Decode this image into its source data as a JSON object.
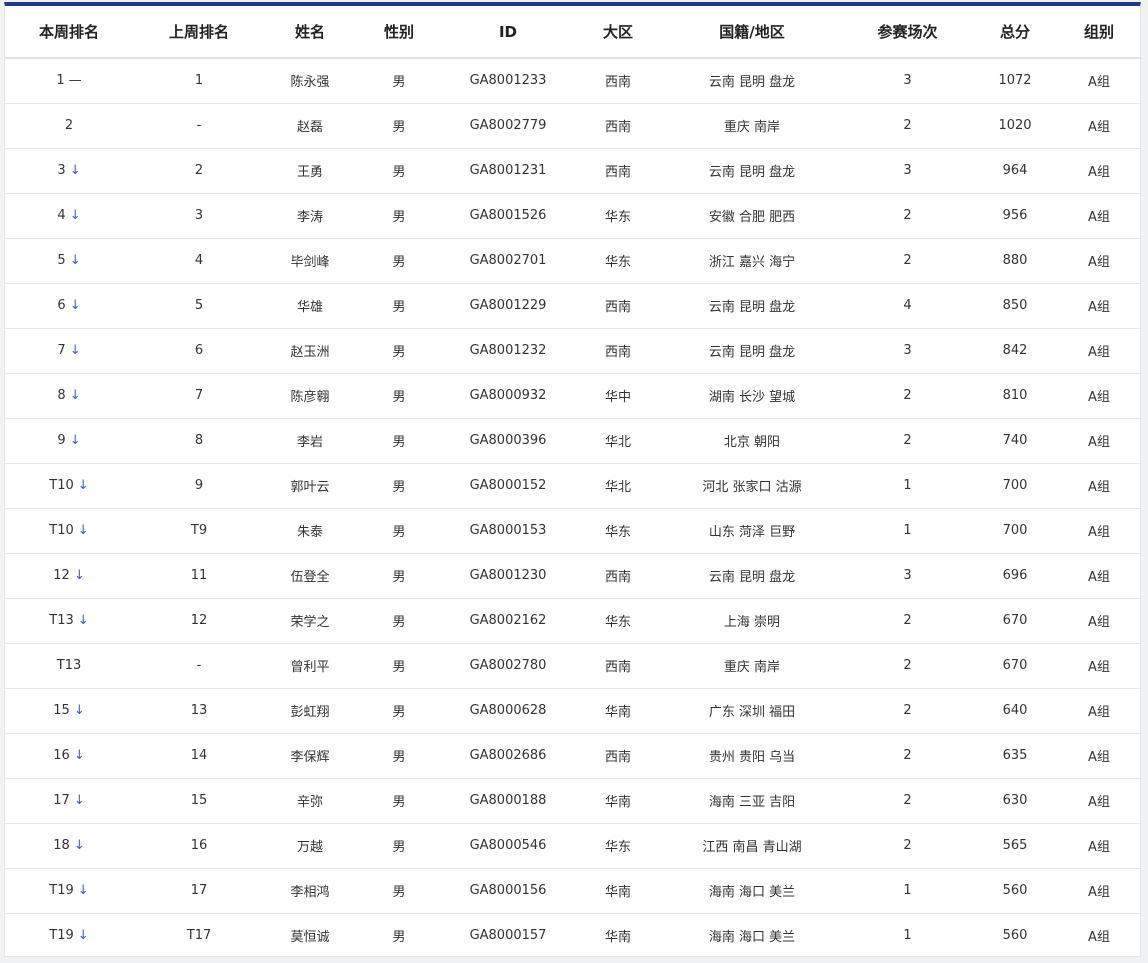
{
  "table": {
    "headers": {
      "rank": "本周排名",
      "prev": "上周排名",
      "name": "姓名",
      "gender": "性别",
      "id": "ID",
      "region": "大区",
      "location": "国籍/地区",
      "games": "参赛场次",
      "score": "总分",
      "group": "组别"
    },
    "rows": [
      {
        "rank": "1",
        "trend": "—",
        "trend_type": "same",
        "prev": "1",
        "name": "陈永强",
        "gender": "男",
        "id": "GA8001233",
        "region": "西南",
        "location": "云南 昆明 盘龙",
        "games": "3",
        "score": "1072",
        "group": "A组"
      },
      {
        "rank": "2",
        "trend": "",
        "trend_type": "none",
        "prev": "-",
        "name": "赵磊",
        "gender": "男",
        "id": "GA8002779",
        "region": "西南",
        "location": "重庆 南岸",
        "games": "2",
        "score": "1020",
        "group": "A组"
      },
      {
        "rank": "3",
        "trend": "↓",
        "trend_type": "down",
        "prev": "2",
        "name": "王勇",
        "gender": "男",
        "id": "GA8001231",
        "region": "西南",
        "location": "云南 昆明 盘龙",
        "games": "3",
        "score": "964",
        "group": "A组"
      },
      {
        "rank": "4",
        "trend": "↓",
        "trend_type": "down",
        "prev": "3",
        "name": "李涛",
        "gender": "男",
        "id": "GA8001526",
        "region": "华东",
        "location": "安徽 合肥 肥西",
        "games": "2",
        "score": "956",
        "group": "A组"
      },
      {
        "rank": "5",
        "trend": "↓",
        "trend_type": "down",
        "prev": "4",
        "name": "毕剑峰",
        "gender": "男",
        "id": "GA8002701",
        "region": "华东",
        "location": "浙江 嘉兴 海宁",
        "games": "2",
        "score": "880",
        "group": "A组"
      },
      {
        "rank": "6",
        "trend": "↓",
        "trend_type": "down",
        "prev": "5",
        "name": "华雄",
        "gender": "男",
        "id": "GA8001229",
        "region": "西南",
        "location": "云南 昆明 盘龙",
        "games": "4",
        "score": "850",
        "group": "A组"
      },
      {
        "rank": "7",
        "trend": "↓",
        "trend_type": "down",
        "prev": "6",
        "name": "赵玉洲",
        "gender": "男",
        "id": "GA8001232",
        "region": "西南",
        "location": "云南 昆明 盘龙",
        "games": "3",
        "score": "842",
        "group": "A组"
      },
      {
        "rank": "8",
        "trend": "↓",
        "trend_type": "down",
        "prev": "7",
        "name": "陈彦翱",
        "gender": "男",
        "id": "GA8000932",
        "region": "华中",
        "location": "湖南 长沙 望城",
        "games": "2",
        "score": "810",
        "group": "A组"
      },
      {
        "rank": "9",
        "trend": "↓",
        "trend_type": "down",
        "prev": "8",
        "name": "李岩",
        "gender": "男",
        "id": "GA8000396",
        "region": "华北",
        "location": "北京 朝阳",
        "games": "2",
        "score": "740",
        "group": "A组"
      },
      {
        "rank": "T10",
        "trend": "↓",
        "trend_type": "down",
        "prev": "9",
        "name": "郭叶云",
        "gender": "男",
        "id": "GA8000152",
        "region": "华北",
        "location": "河北 张家口 沽源",
        "games": "1",
        "score": "700",
        "group": "A组"
      },
      {
        "rank": "T10",
        "trend": "↓",
        "trend_type": "down",
        "prev": "T9",
        "name": "朱泰",
        "gender": "男",
        "id": "GA8000153",
        "region": "华东",
        "location": "山东 菏泽 巨野",
        "games": "1",
        "score": "700",
        "group": "A组"
      },
      {
        "rank": "12",
        "trend": "↓",
        "trend_type": "down",
        "prev": "11",
        "name": "伍登全",
        "gender": "男",
        "id": "GA8001230",
        "region": "西南",
        "location": "云南 昆明 盘龙",
        "games": "3",
        "score": "696",
        "group": "A组"
      },
      {
        "rank": "T13",
        "trend": "↓",
        "trend_type": "down",
        "prev": "12",
        "name": "荣学之",
        "gender": "男",
        "id": "GA8002162",
        "region": "华东",
        "location": "上海 崇明",
        "games": "2",
        "score": "670",
        "group": "A组"
      },
      {
        "rank": "T13",
        "trend": "",
        "trend_type": "none",
        "prev": "-",
        "name": "曾利平",
        "gender": "男",
        "id": "GA8002780",
        "region": "西南",
        "location": "重庆 南岸",
        "games": "2",
        "score": "670",
        "group": "A组"
      },
      {
        "rank": "15",
        "trend": "↓",
        "trend_type": "down",
        "prev": "13",
        "name": "彭虹翔",
        "gender": "男",
        "id": "GA8000628",
        "region": "华南",
        "location": "广东 深圳 福田",
        "games": "2",
        "score": "640",
        "group": "A组"
      },
      {
        "rank": "16",
        "trend": "↓",
        "trend_type": "down",
        "prev": "14",
        "name": "李保辉",
        "gender": "男",
        "id": "GA8002686",
        "region": "西南",
        "location": "贵州 贵阳 乌当",
        "games": "2",
        "score": "635",
        "group": "A组"
      },
      {
        "rank": "17",
        "trend": "↓",
        "trend_type": "down",
        "prev": "15",
        "name": "辛弥",
        "gender": "男",
        "id": "GA8000188",
        "region": "华南",
        "location": "海南 三亚 吉阳",
        "games": "2",
        "score": "630",
        "group": "A组"
      },
      {
        "rank": "18",
        "trend": "↓",
        "trend_type": "down",
        "prev": "16",
        "name": "万越",
        "gender": "男",
        "id": "GA8000546",
        "region": "华东",
        "location": "江西 南昌 青山湖",
        "games": "2",
        "score": "565",
        "group": "A组"
      },
      {
        "rank": "T19",
        "trend": "↓",
        "trend_type": "down",
        "prev": "17",
        "name": "李相鸿",
        "gender": "男",
        "id": "GA8000156",
        "region": "华南",
        "location": "海南 海口 美兰",
        "games": "1",
        "score": "560",
        "group": "A组"
      },
      {
        "rank": "T19",
        "trend": "↓",
        "trend_type": "down",
        "prev": "T17",
        "name": "莫恒诚",
        "gender": "男",
        "id": "GA8000157",
        "region": "华南",
        "location": "海南 海口 美兰",
        "games": "1",
        "score": "560",
        "group": "A组"
      }
    ]
  }
}
